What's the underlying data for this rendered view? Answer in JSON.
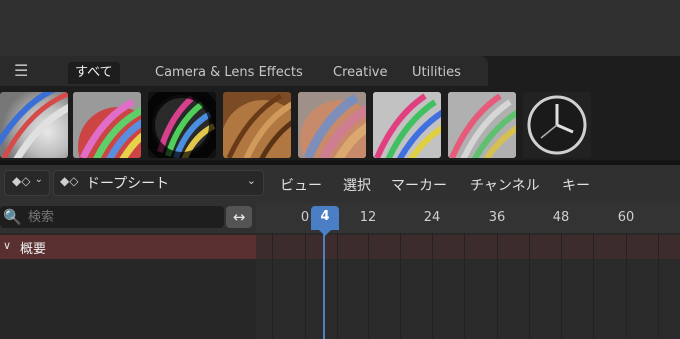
{
  "asset_browser": {
    "tabs": [
      {
        "label": "すべて"
      },
      {
        "label": "Camera & Lens Effects"
      },
      {
        "label": "Creative"
      },
      {
        "label": "Utilities"
      }
    ],
    "thumbnails": [
      {
        "icon": "striped-ball-white"
      },
      {
        "icon": "striped-ball-grayscale-noise"
      },
      {
        "icon": "striped-ball-vignette"
      },
      {
        "icon": "striped-ball-sepia"
      },
      {
        "icon": "striped-ball-blur"
      },
      {
        "icon": "striped-ball-sharp"
      },
      {
        "icon": "striped-ball-soft"
      },
      {
        "icon": "clock-icon"
      }
    ]
  },
  "header": {
    "editor_type": "ドープシート",
    "menus": [
      "ビュー",
      "選択",
      "マーカー",
      "チャンネル",
      "キー"
    ]
  },
  "channels": {
    "search_placeholder": "検索",
    "summary_label": "概要"
  },
  "timeline": {
    "current_frame": "4",
    "ticks": [
      "0",
      "12",
      "24",
      "36",
      "48",
      "60"
    ]
  },
  "colors": {
    "playhead": "#4a7fc5",
    "summary_row": "#5a2f2f"
  }
}
